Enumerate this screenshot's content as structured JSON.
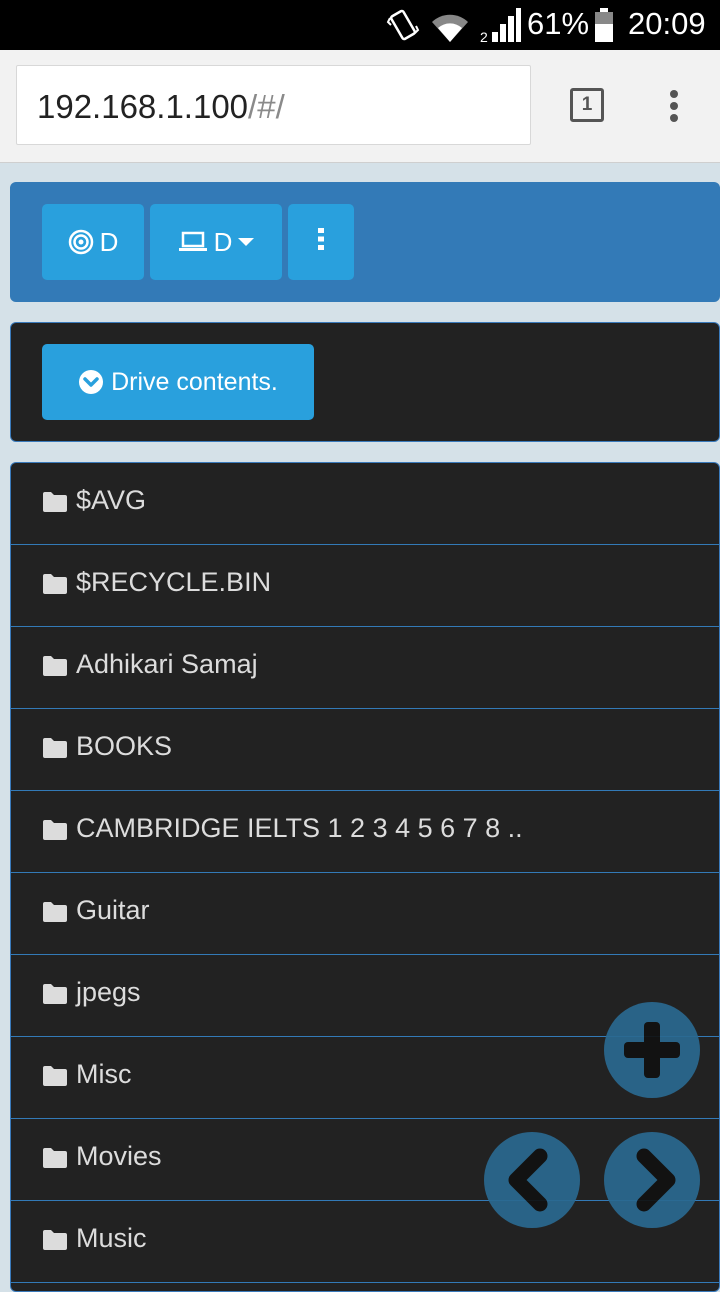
{
  "status": {
    "battery": "61%",
    "time": "20:09"
  },
  "browser": {
    "url_host": "192.168.1.100",
    "url_path": "/#/",
    "tab_count": "1"
  },
  "toolbar": {
    "drive_button_label": "D",
    "device_button_label": "D",
    "drive_icon": "target-icon",
    "device_icon": "laptop-icon",
    "more_icon": "more-vertical-icon"
  },
  "contents_header": {
    "label": "Drive contents.",
    "icon": "chevron-circle-down-icon"
  },
  "folders": [
    "$AVG",
    "$RECYCLE.BIN",
    "Adhikari Samaj",
    "BOOKS",
    "CAMBRIDGE IELTS 1 2 3 4 5 6 7 8 ..",
    "Guitar",
    "jpegs",
    "Misc",
    "Movies",
    "Music"
  ],
  "floating_buttons": {
    "add_icon": "plus-icon",
    "prev_icon": "chevron-left-icon",
    "next_icon": "chevron-right-icon"
  },
  "colors": {
    "accent": "#29a0dd",
    "panel_blue": "#337ab7",
    "dark_panel": "#222222",
    "fab": "#2a6990"
  }
}
